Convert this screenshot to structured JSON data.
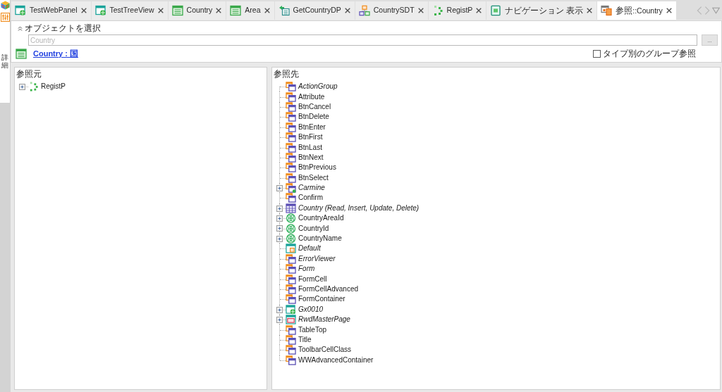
{
  "sidebar": {
    "tab_label": "詳細"
  },
  "tabs": [
    {
      "label": "TestWebPanel",
      "kind": "webpanel",
      "selected": false
    },
    {
      "label": "TestTreeView",
      "kind": "webpanel",
      "selected": false
    },
    {
      "label": "Country",
      "kind": "transaction",
      "selected": false
    },
    {
      "label": "Area",
      "kind": "transaction",
      "selected": false
    },
    {
      "label": "GetCountryDP",
      "kind": "dataprovider",
      "selected": false
    },
    {
      "label": "CountrySDT",
      "kind": "sdt",
      "selected": false
    },
    {
      "label": "RegistP",
      "kind": "procedure",
      "selected": false
    },
    {
      "label": "ナビゲーション 表示",
      "kind": "navigation",
      "selected": false
    },
    {
      "label": "参照::Country",
      "kind": "references",
      "selected": true
    }
  ],
  "object_selector": {
    "title": "オブジェクトを選択",
    "placeholder": "Country",
    "browse_button": "...",
    "object_link": "Country : 国",
    "group_by_type": {
      "label": "タイプ別のグループ参照",
      "checked": false
    }
  },
  "referenced_by": {
    "title": "参照元",
    "items": [
      {
        "name": "RegistP",
        "kind": "procedure",
        "italic": false,
        "expanded": false
      }
    ]
  },
  "references": {
    "title": "参照先",
    "items": [
      {
        "name": "ActionGroup",
        "kind": "theme-class",
        "italic": true
      },
      {
        "name": "Attribute",
        "kind": "theme-class",
        "italic": false
      },
      {
        "name": "BtnCancel",
        "kind": "theme-class",
        "italic": false
      },
      {
        "name": "BtnDelete",
        "kind": "theme-class",
        "italic": false
      },
      {
        "name": "BtnEnter",
        "kind": "theme-class",
        "italic": false
      },
      {
        "name": "BtnFirst",
        "kind": "theme-class",
        "italic": false
      },
      {
        "name": "BtnLast",
        "kind": "theme-class",
        "italic": false
      },
      {
        "name": "BtnNext",
        "kind": "theme-class",
        "italic": false
      },
      {
        "name": "BtnPrevious",
        "kind": "theme-class",
        "italic": false
      },
      {
        "name": "BtnSelect",
        "kind": "theme-class",
        "italic": false
      },
      {
        "name": "Carmine",
        "kind": "webpanel-class",
        "italic": true,
        "expanded": false
      },
      {
        "name": "Confirm",
        "kind": "theme-class",
        "italic": false
      },
      {
        "name": "Country (Read, Insert, Update, Delete)",
        "kind": "table",
        "italic": true,
        "expanded": false
      },
      {
        "name": "CountryAreaId",
        "kind": "attribute",
        "italic": false,
        "expanded": false
      },
      {
        "name": "CountryId",
        "kind": "attribute",
        "italic": false,
        "expanded": false
      },
      {
        "name": "CountryName",
        "kind": "attribute",
        "italic": false,
        "expanded": false
      },
      {
        "name": "Default",
        "kind": "theme",
        "italic": true
      },
      {
        "name": "ErrorViewer",
        "kind": "theme-class",
        "italic": true
      },
      {
        "name": "Form",
        "kind": "theme-class",
        "italic": true
      },
      {
        "name": "FormCell",
        "kind": "theme-class",
        "italic": false
      },
      {
        "name": "FormCellAdvanced",
        "kind": "theme-class",
        "italic": false
      },
      {
        "name": "FormContainer",
        "kind": "theme-class",
        "italic": false
      },
      {
        "name": "Gx0010",
        "kind": "webpanel",
        "italic": true,
        "expanded": false
      },
      {
        "name": "RwdMasterPage",
        "kind": "masterpage",
        "italic": true,
        "expanded": false
      },
      {
        "name": "TableTop",
        "kind": "theme-class",
        "italic": false
      },
      {
        "name": "Title",
        "kind": "theme-class",
        "italic": false
      },
      {
        "name": "ToolbarCellClass",
        "kind": "theme-class",
        "italic": false
      },
      {
        "name": "WWAdvancedContainer",
        "kind": "theme-class",
        "italic": false
      }
    ]
  }
}
